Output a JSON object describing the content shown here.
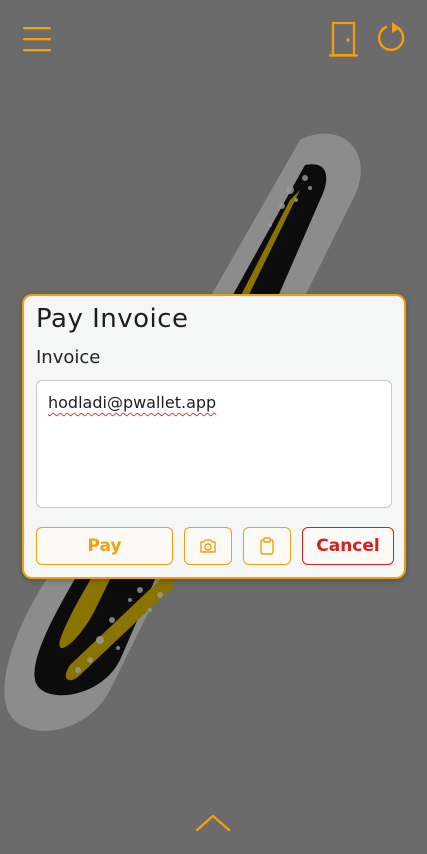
{
  "header": {
    "menu_icon": "hamburger-icon",
    "exit_icon": "door-exit-icon",
    "refresh_icon": "refresh-icon"
  },
  "dialog": {
    "title": "Pay Invoice",
    "field_label": "Invoice",
    "invoice_value": "hodladi@pwallet.app",
    "pay_label": "Pay",
    "camera_icon": "camera-icon",
    "paste_icon": "clipboard-icon",
    "cancel_label": "Cancel"
  },
  "footer": {
    "expand_icon": "chevron-up-icon"
  },
  "colors": {
    "accent": "#f59e0b",
    "danger": "#d81e1e",
    "background": "#6b6b6b",
    "dialog_bg": "#f5f6f6"
  }
}
